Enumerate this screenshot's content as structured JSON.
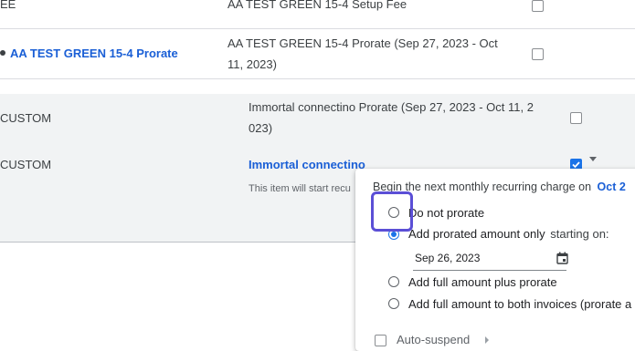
{
  "rows": {
    "row1": {
      "name": "EE",
      "description": "AA TEST GREEN 15-4 Setup Fee"
    },
    "row2": {
      "name": "AA TEST GREEN 15-4 Prorate",
      "description_line1": "AA TEST GREEN 15-4 Prorate (Sep 27, 2023 - Oct",
      "description_line2": "11, 2023)"
    },
    "row3": {
      "type": "CUSTOM",
      "description_line1": "Immortal connectino Prorate (Sep 27, 2023 - Oct 11, 2",
      "description_line2": "023)"
    },
    "row4": {
      "type": "CUSTOM",
      "name": "Immortal connectino",
      "note": "This item will start recu"
    }
  },
  "popup": {
    "header": "Begin the next monthly recurring charge on",
    "header_date": "Oct 2",
    "options": [
      {
        "label": "Do not prorate",
        "selected": false
      },
      {
        "label": "Add prorated amount only",
        "suffix": "starting on:",
        "selected": true
      },
      {
        "label": "Add full amount plus prorate",
        "selected": false
      },
      {
        "label": "Add full amount to both invoices (prorate a",
        "selected": false
      }
    ],
    "date_value": "Sep 26, 2023",
    "auto_suspend_label": "Auto-suspend"
  },
  "colors": {
    "accent": "#1a73e8",
    "link": "#1a5fd6",
    "focus": "#5b4fd6"
  }
}
